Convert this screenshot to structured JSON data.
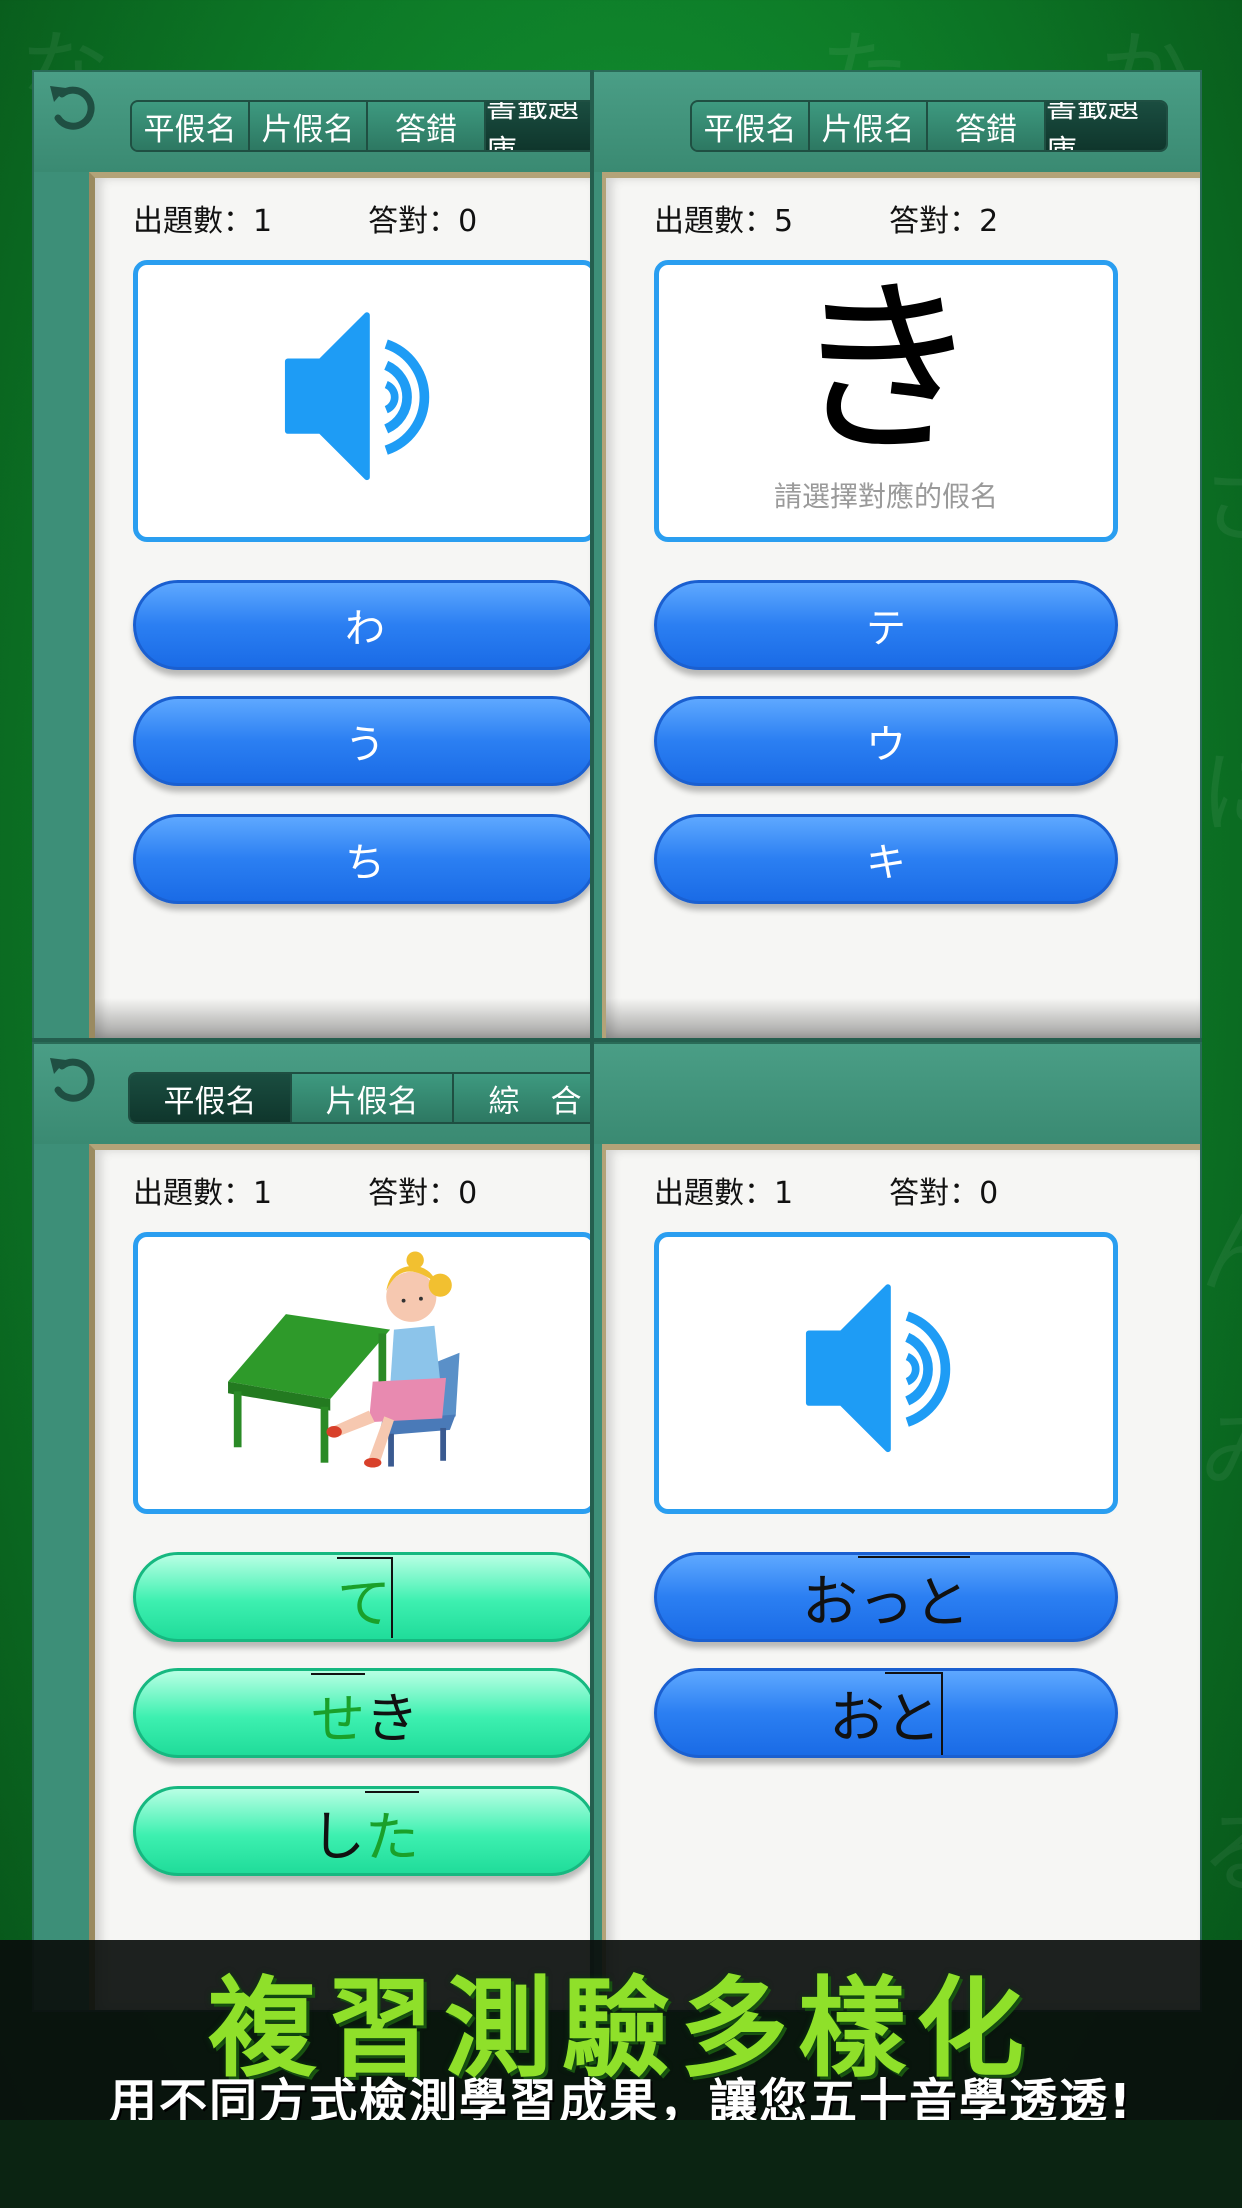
{
  "bg_kana": [
    "な",
    "た",
    "か",
    "さ",
    "に",
    "ん",
    "み",
    "る"
  ],
  "q1": {
    "tabs": [
      "平假名",
      "片假名",
      "答錯",
      "書籤題庫"
    ],
    "active_tab": 3,
    "stats": {
      "questions": "出題數：1",
      "correct": "答對：0"
    },
    "prompt_icon": "speaker-icon",
    "answers": [
      "わ",
      "う",
      "ち"
    ]
  },
  "q2": {
    "tabs": [
      "平假名",
      "片假名",
      "答錯",
      "書籤題庫"
    ],
    "active_tab": 3,
    "stats": {
      "questions": "出題數：5",
      "correct": "答對：2"
    },
    "prompt_kana": "き",
    "prompt_hint": "請選擇對應的假名",
    "answers": [
      "テ",
      "ウ",
      "キ"
    ]
  },
  "q3": {
    "tabs": [
      "平假名",
      "片假名",
      "綜　合"
    ],
    "active_tab": 0,
    "stats": {
      "questions": "出題數：1",
      "correct": "答對：0"
    },
    "prompt_icon": "girl-at-desk-illustration",
    "answers": [
      {
        "green": "て",
        "black": ""
      },
      {
        "green": "せ",
        "black": "き"
      },
      {
        "black_first": "し",
        "green": "た"
      }
    ]
  },
  "q4": {
    "stats": {
      "questions": "出題數：1",
      "correct": "答對：0"
    },
    "prompt_icon": "speaker-icon",
    "answers": [
      {
        "a": "お",
        "b": "っと"
      },
      {
        "a": "お",
        "b": "と"
      }
    ]
  },
  "banner": {
    "title": "複習測驗多樣化",
    "subtitle": "用不同方式檢測學習成果，讓您五十音學透透!"
  },
  "colors": {
    "accent_blue": "#2a9ef0",
    "answer_blue": "#2b7ff2",
    "answer_green": "#3df0b0",
    "title_green": "#8fe02a",
    "panel_teal": "#3d8f78"
  }
}
